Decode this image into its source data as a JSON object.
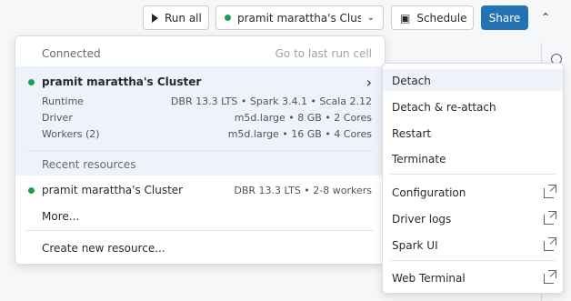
{
  "toolbar": {
    "run_all": "Run all",
    "cluster": "pramit marattha's Clust...",
    "schedule": "Schedule",
    "share": "Share"
  },
  "cluster_menu": {
    "connected_heading": "Connected",
    "go_to_last": "Go to last run cell",
    "current": {
      "name": "pramit marattha's Cluster",
      "rows": [
        {
          "label": "Runtime",
          "value": "DBR 13.3 LTS • Spark 3.4.1 • Scala 2.12"
        },
        {
          "label": "Driver",
          "value": "m5d.large • 8 GB • 2 Cores"
        },
        {
          "label": "Workers (2)",
          "value": "m5d.large • 16 GB • 4 Cores"
        }
      ]
    },
    "recent_heading": "Recent resources",
    "recent": [
      {
        "name": "pramit marattha's Cluster",
        "value": "DBR 13.3 LTS • 2-8 workers"
      }
    ],
    "more": "More...",
    "create": "Create new resource..."
  },
  "context_menu": {
    "items": [
      "Detach",
      "Detach & re-attach",
      "Restart",
      "Terminate"
    ],
    "links": [
      "Configuration",
      "Driver logs",
      "Spark UI"
    ],
    "terminal": "Web Terminal"
  },
  "colors": {
    "primary": "#2272b4",
    "status_green": "#1f9d55"
  }
}
